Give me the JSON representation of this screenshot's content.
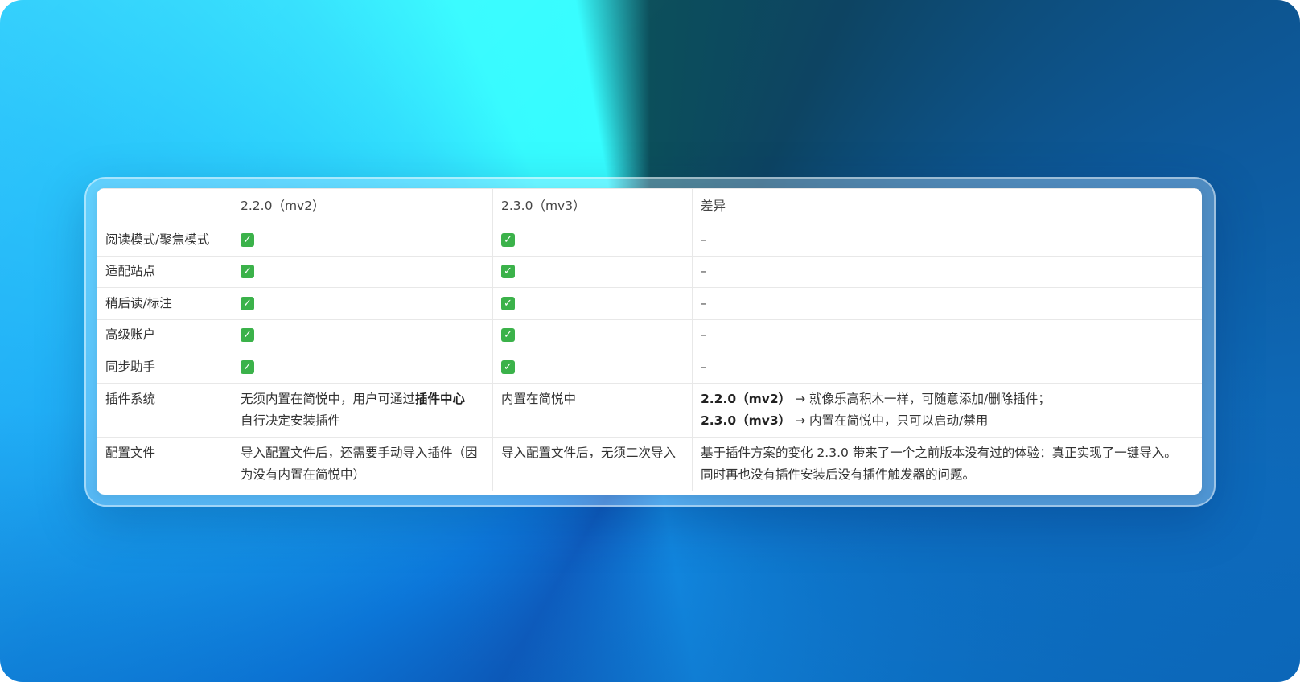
{
  "colors": {
    "check_green": "#3bb24a",
    "text": "#333333",
    "border": "#e8e8e8"
  },
  "icons": {
    "check": "white-check-mark-icon"
  },
  "table": {
    "headers": [
      "",
      "2.2.0（mv2）",
      "2.3.0（mv3）",
      "差异"
    ],
    "rows": [
      {
        "feature": "阅读模式/聚焦模式",
        "v220": "✓",
        "v230": "✓",
        "diff": "–"
      },
      {
        "feature": "适配站点",
        "v220": "✓",
        "v230": "✓",
        "diff": "–"
      },
      {
        "feature": "稍后读/标注",
        "v220": "✓",
        "v230": "✓",
        "diff": "–"
      },
      {
        "feature": "高级账户",
        "v220": "✓",
        "v230": "✓",
        "diff": "–"
      },
      {
        "feature": "同步助手",
        "v220": "✓",
        "v230": "✓",
        "diff": "–"
      },
      {
        "feature": "插件系统",
        "v220_pre": "无须内置在简悦中，用户可通过",
        "v220_bold": "插件中心",
        "v220_post": "自行决定安装插件",
        "v230": "内置在简悦中",
        "diff_line1_bold": "2.2.0（mv2）",
        "diff_line1_text": " → 就像乐高积木一样，可随意添加/删除插件；",
        "diff_line2_bold": "2.3.0（mv3）",
        "diff_line2_text": " → 内置在简悦中，只可以启动/禁用"
      },
      {
        "feature": "配置文件",
        "v220": "导入配置文件后，还需要手动导入插件（因为没有内置在简悦中）",
        "v230": "导入配置文件后，无须二次导入",
        "diff_line1": "基于插件方案的变化 2.3.0 带来了一个之前版本没有过的体验：真正实现了一键导入。",
        "diff_line2": "同时再也没有插件安装后没有插件触发器的问题。"
      }
    ]
  }
}
